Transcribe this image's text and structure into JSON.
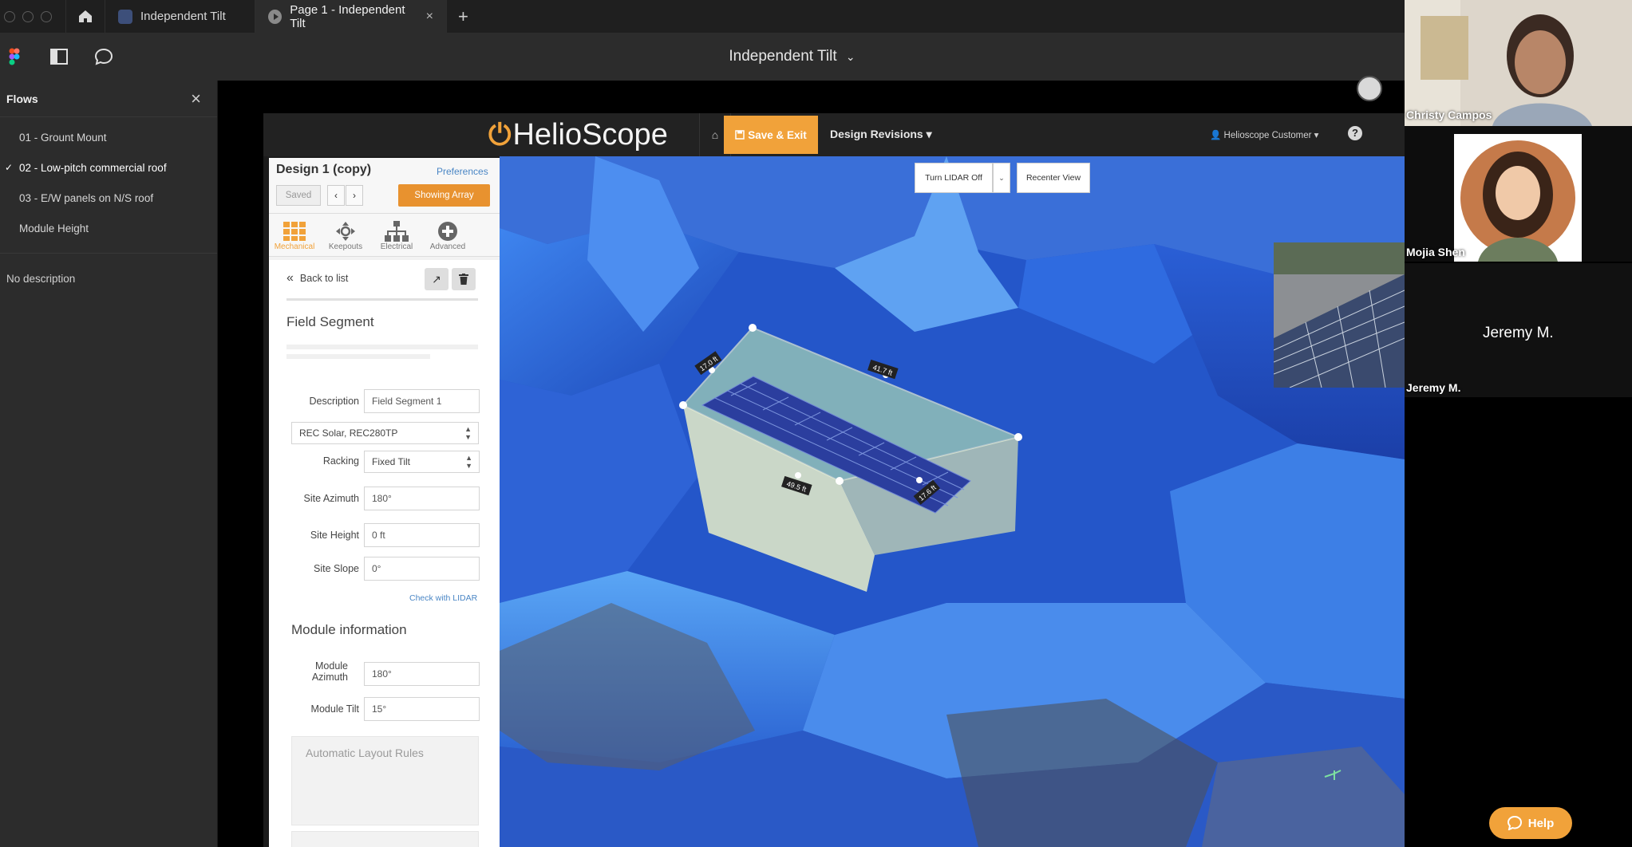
{
  "figma": {
    "tabs": [
      {
        "label": "Independent Tilt"
      },
      {
        "label": "Page 1 - Independent Tilt",
        "close": "×"
      }
    ],
    "new_tab": "+",
    "file_title": "Independent Tilt",
    "file_title_caret": "⌄"
  },
  "flows": {
    "title": "Flows",
    "close": "×",
    "items": [
      {
        "label": "01 - Grount Mount",
        "checked": false
      },
      {
        "label": "02 - Low-pitch commercial roof",
        "checked": true
      },
      {
        "label": "03 - E/W panels on N/S roof",
        "checked": false
      },
      {
        "label": "Module Height",
        "checked": false
      }
    ],
    "check_mark": "✓",
    "no_description": "No description"
  },
  "app": {
    "logo": "HelioScope",
    "home_icon": "⌂",
    "save_exit": "Save & Exit",
    "design_revisions": "Design Revisions ▾",
    "customer": "Helioscope Customer ▾",
    "help_q": "?",
    "accent": "#f1a23a",
    "design_panel": {
      "title": "Design 1 (copy)",
      "preferences": "Preferences",
      "saved": "Saved",
      "prev": "‹",
      "next": "›",
      "showing": "Showing Array",
      "tabs": [
        {
          "label": "Mechanical",
          "icon": "grid-icon",
          "active": true
        },
        {
          "label": "Keepouts",
          "icon": "crosshair-icon",
          "active": false
        },
        {
          "label": "Electrical",
          "icon": "hierarchy-icon",
          "active": false
        },
        {
          "label": "Advanced",
          "icon": "plus-circle-icon",
          "active": false
        }
      ]
    },
    "field_segment": {
      "back": "Back to list",
      "title": "Field Segment",
      "description_label": "Description",
      "description_value": "Field Segment 1",
      "module_select": "REC Solar, REC280TP",
      "racking_label": "Racking",
      "racking_value": "Fixed Tilt",
      "site_azimuth_label": "Site Azimuth",
      "site_azimuth_value": "180°",
      "site_height_label": "Site Height",
      "site_height_value": "0 ft",
      "site_slope_label": "Site Slope",
      "site_slope_value": "0°",
      "check_lidar": "Check with LIDAR",
      "module_info_title": "Module information",
      "module_azimuth_label": "Module Azimuth",
      "module_azimuth_value": "180°",
      "module_tilt_label": "Module Tilt",
      "module_tilt_value": "15°",
      "auto_layout": "Automatic Layout Rules"
    },
    "scene": {
      "lidar_btn": "Turn LIDAR Off",
      "lidar_caret": "⌄",
      "recenter": "Recenter View",
      "dims": [
        "17.0 ft",
        "41.7 ft",
        "49.5 ft",
        "17.6 ft"
      ]
    },
    "help": "Help"
  },
  "participants": {
    "p1": "Christy Campos",
    "p2": "Mojia Shen",
    "p3": "Jeremy M.",
    "p3_tile": "Jeremy M."
  }
}
